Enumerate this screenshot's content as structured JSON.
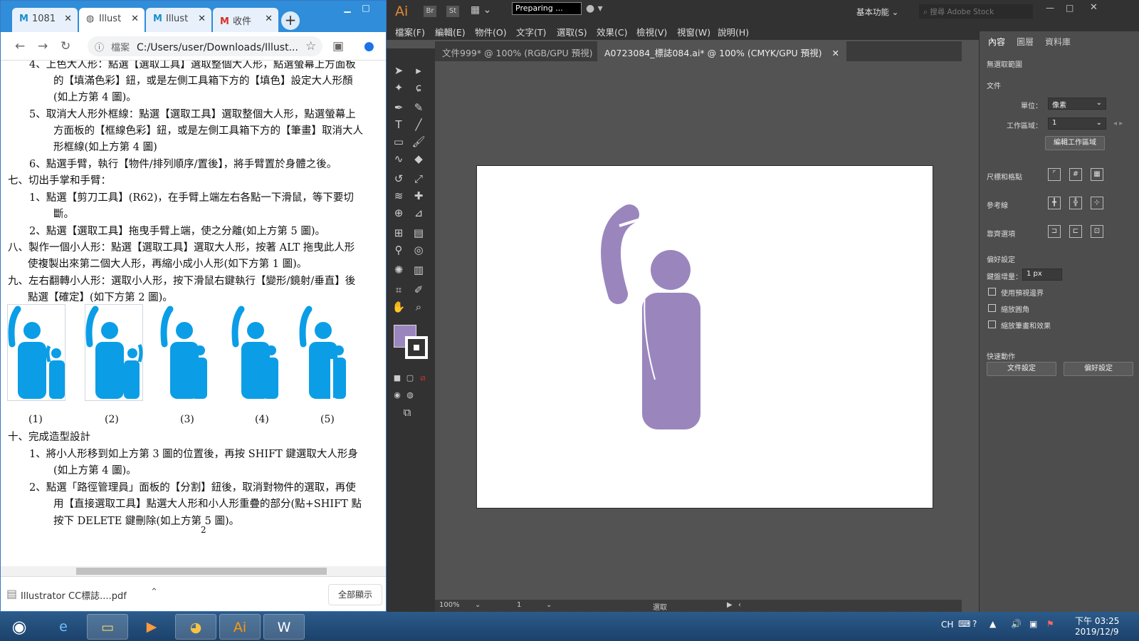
{
  "chrome": {
    "tabs": [
      {
        "label": "1081",
        "icon": "gmail-icon"
      },
      {
        "label": "Illust",
        "icon": "globe-icon"
      },
      {
        "label": "Illust",
        "icon": "gmail-icon"
      },
      {
        "label": "收件",
        "icon": "gmail-icon"
      }
    ],
    "address_prefix": "檔案",
    "address": "C:/Users/user/Downloads/Illust...",
    "download_file": "Illustrator CC標誌....pdf",
    "show_all": "全部顯示"
  },
  "pdf": {
    "lines": [
      "4、上色大人形：點選【選取工具】選取整個大人形，點選螢幕上方面板",
      "的【填滿色彩】鈕，或是左側工具箱下方的【填色】設定大人形顏",
      "(如上方第 4 圖)。",
      "5、取消大人形外框線：點選【選取工具】選取整個大人形，點選螢幕上",
      "方面板的【框線色彩】鈕，或是左側工具箱下方的【筆畫】取消大人",
      "形框線(如上方第 4 圖)",
      "6、點選手臂，執行【物件/排列順序/置後】，將手臂置於身體之後。",
      "七、切出手掌和手臂：",
      "1、點選【剪刀工具】(R62)，在手臂上端左右各點一下滑鼠，等下要切",
      "斷。",
      "2、點選【選取工具】拖曳手臂上端，使之分離(如上方第 5 圖)。",
      "八、製作一個小人形：點選【選取工具】選取大人形，按著 ALT 拖曳此人形",
      "使複製出來第二個大人形，再縮小成小人形(如下方第 1 圖)。",
      "九、左右翻轉小人形：選取小人形，按下滑鼠右鍵執行【變形/鏡射/垂直】後",
      "點選【確定】(如下方第 2 圖)。",
      "十、完成造型設計",
      "1、將小人形移到如上方第 3 圖的位置後，再按 SHIFT 鍵選取大人形身",
      "(如上方第 4 圖)。",
      "2、點選「路徑管理員」面板的【分割】鈕後，取消對物件的選取，再使",
      "用【直接選取工具】點選大人形和小人形重疊的部分(點+SHIFT 點",
      "按下 DELETE 鍵刪除(如上方第 5 圖)。"
    ],
    "figure_captions": [
      "(1)",
      "(2)",
      "(3)",
      "(4)",
      "(5)"
    ],
    "page_number": "2",
    "figure_color": "#0b9ee6"
  },
  "illustrator": {
    "logo": "Ai",
    "bridge": "Br",
    "stock": "St",
    "status": "Preparing ...",
    "workspace": "基本功能",
    "search_placeholder": "搜尋 Adobe Stock",
    "menu": [
      "檔案(F)",
      "編輯(E)",
      "物件(O)",
      "文字(T)",
      "選取(S)",
      "效果(C)",
      "檢視(V)",
      "視窗(W)",
      "說明(H)"
    ],
    "doc_tabs": [
      {
        "label": "文件999* @ 100% (RGB/GPU 預視)"
      },
      {
        "label": "A0723084_標誌084.ai* @ 100% (CMYK/GPU 預視)"
      }
    ],
    "figure_color": "#9a86bd",
    "status_bar": {
      "zoom": "100%",
      "artboard": "1",
      "tool": "選取"
    },
    "panel": {
      "tabs": [
        "內容",
        "圖層",
        "資料庫"
      ],
      "no_selection": "無選取範圍",
      "document": "文件",
      "unit_label": "單位：",
      "unit_value": "像素",
      "artboard_label": "工作區域：",
      "artboard_value": "1",
      "edit_artboard": "編輯工作區域",
      "rulers_grids": "尺標和格點",
      "guides": "參考線",
      "snap_options": "靠齊選項",
      "preferences": "偏好設定",
      "keyboard_increment_label": "鍵盤增量：",
      "keyboard_increment_value": "1 px",
      "checkboxes": [
        "使用預視邊界",
        "縮放圓角",
        "縮放筆畫和效果"
      ],
      "quick_actions": "快速動作",
      "doc_setup": "文件設定",
      "prefs_button": "偏好設定"
    }
  },
  "taskbar": {
    "ime": "CH",
    "time": "下午 03:25",
    "date": "2019/12/9"
  }
}
